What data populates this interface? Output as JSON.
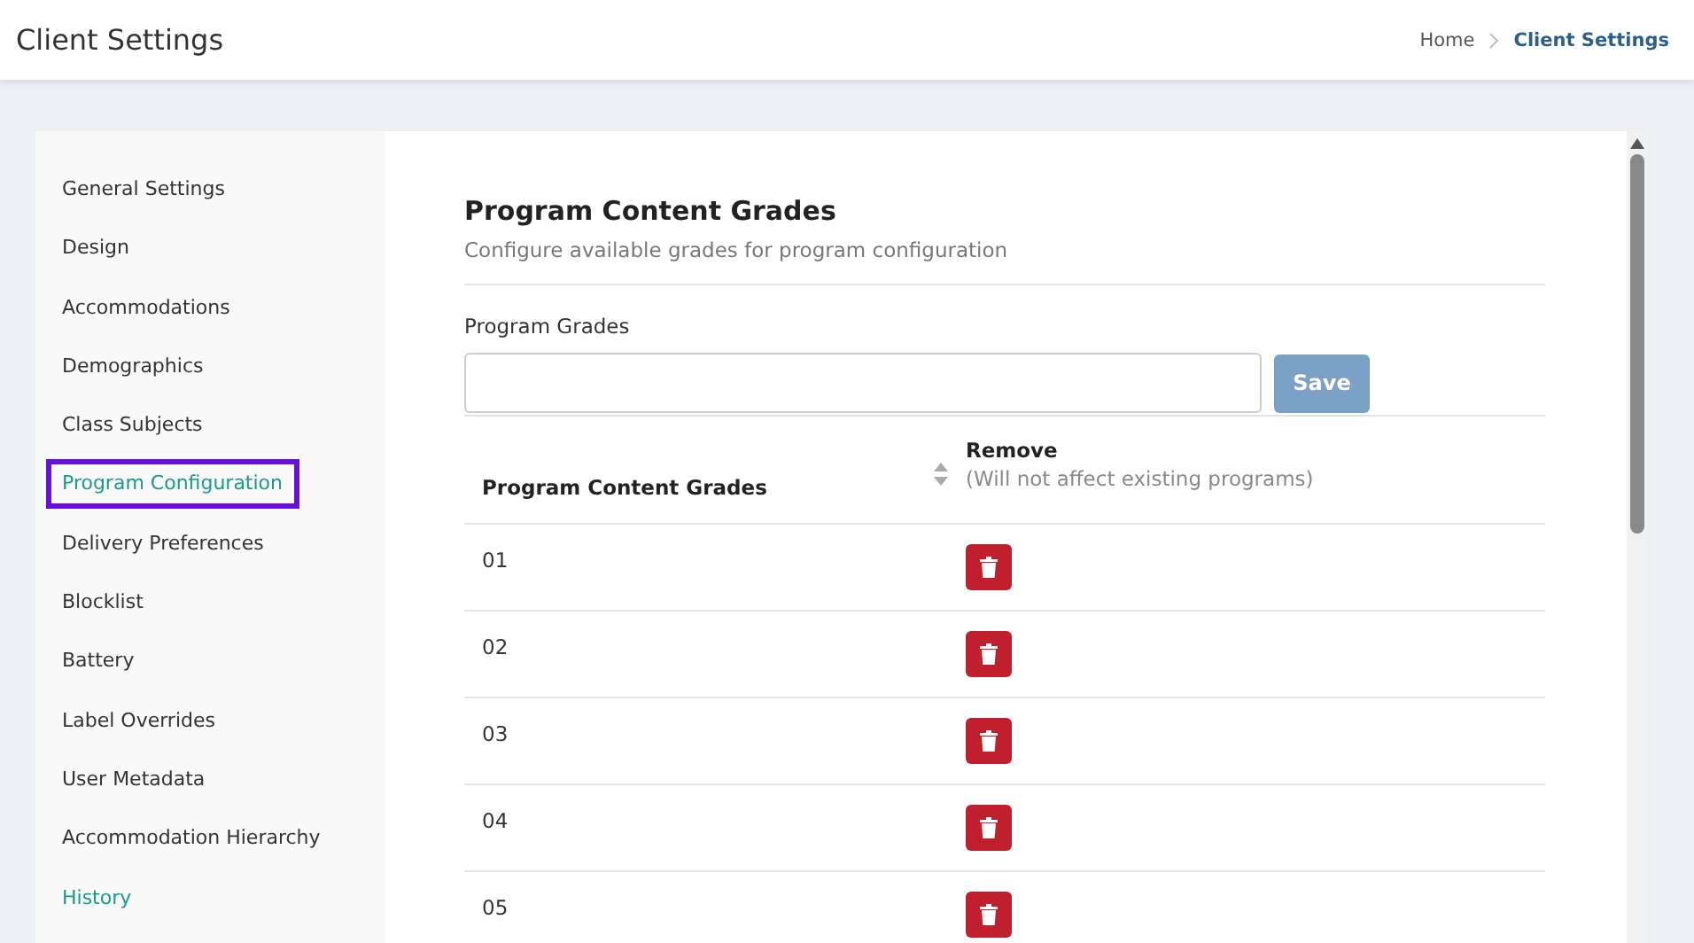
{
  "header": {
    "title": "Client Settings",
    "breadcrumb": [
      {
        "label": "Home",
        "selected": false
      },
      {
        "label": "Client Settings",
        "selected": true
      }
    ]
  },
  "sidebar": {
    "items": [
      {
        "label": "General Settings",
        "kind": "page",
        "selected": false
      },
      {
        "label": "Design",
        "kind": "page",
        "selected": false
      },
      {
        "label": "Accommodations",
        "kind": "page",
        "selected": false
      },
      {
        "label": "Demographics",
        "kind": "page",
        "selected": false
      },
      {
        "label": "Class Subjects",
        "kind": "page",
        "selected": false
      },
      {
        "label": "Program Configuration",
        "kind": "page",
        "selected": true
      },
      {
        "label": "Delivery Preferences",
        "kind": "page",
        "selected": false
      },
      {
        "label": "Blocklist",
        "kind": "page",
        "selected": false
      },
      {
        "label": "Battery",
        "kind": "page",
        "selected": false
      },
      {
        "label": "Label Overrides",
        "kind": "page",
        "selected": false
      },
      {
        "label": "User Metadata",
        "kind": "page",
        "selected": false
      },
      {
        "label": "Accommodation Hierarchy",
        "kind": "page",
        "selected": false
      },
      {
        "label": "History",
        "kind": "link",
        "selected": false
      }
    ]
  },
  "section": {
    "title": "Program Content Grades",
    "subtitle": "Configure available grades for program configuration",
    "field_label": "Program Grades",
    "save_button": "Save"
  },
  "table": {
    "columns": [
      {
        "title": "Program Content Grades"
      },
      {
        "title": "Remove",
        "note": "(Will not affect existing programs)"
      }
    ],
    "rows": [
      {
        "grade": "01"
      },
      {
        "grade": "02"
      },
      {
        "grade": "03"
      },
      {
        "grade": "04"
      },
      {
        "grade": "05"
      }
    ]
  }
}
